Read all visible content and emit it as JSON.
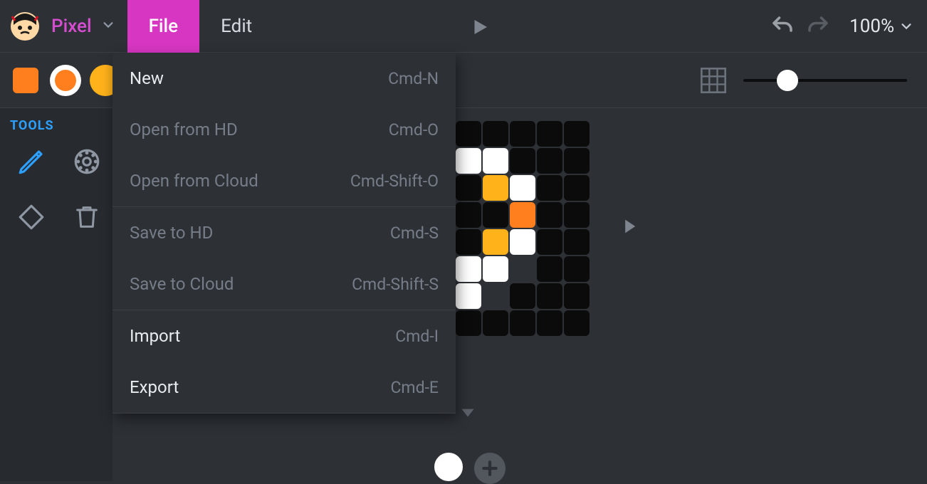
{
  "brand": {
    "name": "Pixel"
  },
  "menubar": {
    "file": "File",
    "edit": "Edit"
  },
  "toolbar": {
    "zoom_label": "100%"
  },
  "file_menu": [
    {
      "label": "New",
      "shortcut": "Cmd-N",
      "enabled": true
    },
    {
      "label": "Open from HD",
      "shortcut": "Cmd-O",
      "enabled": false
    },
    {
      "label": "Open from Cloud",
      "shortcut": "Cmd-Shift-O",
      "enabled": false
    },
    {
      "label": "Save to HD",
      "shortcut": "Cmd-S",
      "enabled": false
    },
    {
      "label": "Save to Cloud",
      "shortcut": "Cmd-Shift-S",
      "enabled": false
    },
    {
      "label": "Import",
      "shortcut": "Cmd-I",
      "enabled": true
    },
    {
      "label": "Export",
      "shortcut": "Cmd-E",
      "enabled": true
    }
  ],
  "sidebar": {
    "heading": "TOOLS"
  },
  "colors": {
    "primary": "#ff7f1f",
    "secondary": "#ffb21a",
    "accent": "#d736c2"
  }
}
